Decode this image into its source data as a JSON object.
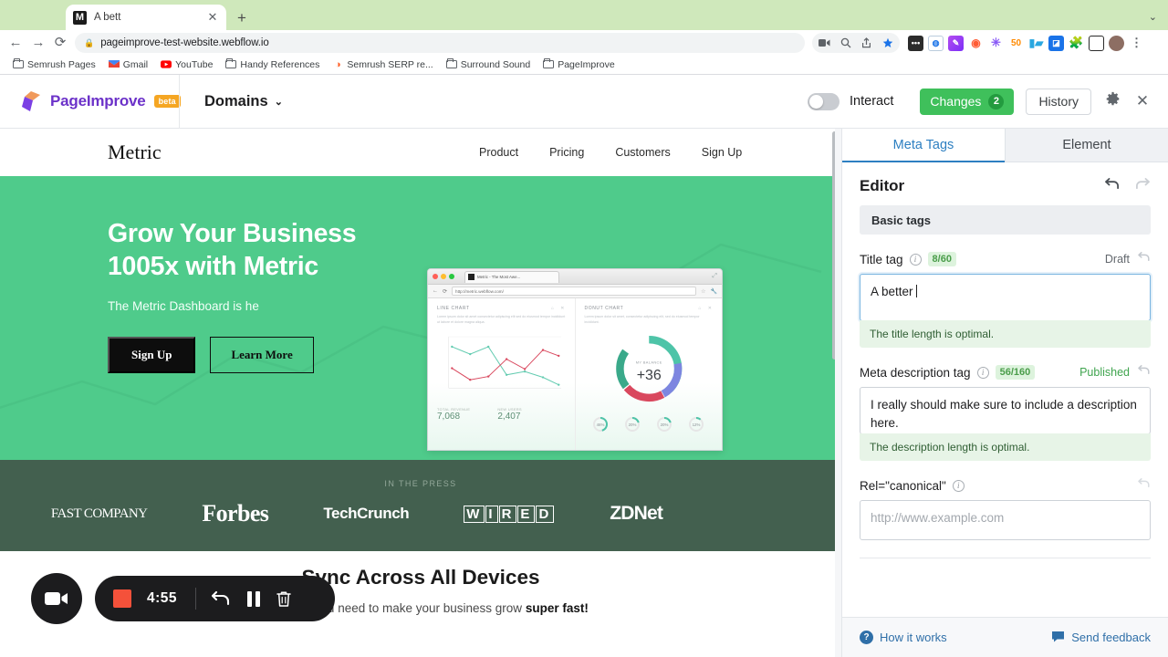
{
  "browser": {
    "tab": {
      "favicon_letter": "M",
      "title": "A bett",
      "close_label": "✕"
    },
    "new_tab_label": "+",
    "window_chevron": "⌄",
    "nav": {
      "back": "←",
      "forward": "→",
      "reload": "⟳"
    },
    "url": {
      "lock_icon": "lock-icon",
      "text": "pageimprove-test-website.webflow.io"
    },
    "toolbar_icons": [
      "video-call-icon",
      "search-icon",
      "share-icon",
      "bookmark-star-icon"
    ],
    "extensions": [
      "puzzle-dots-icon",
      "semrush-icon",
      "highlighter-icon",
      "eye-icon",
      "asterisk-icon",
      "fifty-icon",
      "grid-icon",
      "analytics-icon",
      "puzzle-icon",
      "sidebar-icon"
    ],
    "profile_icon": "avatar",
    "menu_icon": "kebab-menu-icon",
    "bookmarks": [
      {
        "label": "Semrush Pages",
        "icon": "folder-icon"
      },
      {
        "label": "Gmail",
        "icon": "gmail-icon"
      },
      {
        "label": "YouTube",
        "icon": "youtube-icon"
      },
      {
        "label": "Handy References",
        "icon": "folder-icon"
      },
      {
        "label": "Semrush SERP re...",
        "icon": "semrush-icon"
      },
      {
        "label": "Surround Sound",
        "icon": "folder-icon"
      },
      {
        "label": "PageImprove",
        "icon": "folder-icon"
      }
    ]
  },
  "app_header": {
    "brand": "PageImprove",
    "beta_label": "beta",
    "domains_label": "Domains",
    "domains_chevron": "⌄",
    "interact_label": "Interact",
    "interact_on": false,
    "changes_label": "Changes",
    "changes_count": "2",
    "history_label": "History",
    "settings_icon": "gear-icon",
    "close_icon": "close-icon",
    "accent_green": "#3fc05b",
    "brand_purple": "#6c32c9",
    "beta_orange": "#f5a623"
  },
  "website": {
    "logo": "Metric",
    "nav_links": [
      "Product",
      "Pricing",
      "Customers",
      "Sign Up"
    ],
    "hero": {
      "heading": "Grow Your Business 1005x with Metric",
      "subheading": "The Metric Dashboard is he",
      "primary_button": "Sign Up",
      "secondary_button": "Learn More",
      "bg_color": "#4fcb8b"
    },
    "mock_screenshot": {
      "tab_title": "Metric - The Most Awe...",
      "url": "http://metric.webflow.com/",
      "line_chart": {
        "title": "LINE CHART",
        "body": "Lorem ipsum dolor sit amet consectetur adipiscing elit sed do eiusmod tempor incididunt ut labore et dolore magna aliqua."
      },
      "donut_chart": {
        "title": "DONUT CHART",
        "body": "Lorem ipsum dolor sit amet, consectetur adipiscing elit, sed do eiusmod tempor incididunt.",
        "center_label": "MY BALANCE",
        "center_value": "+36"
      },
      "stats": [
        {
          "label": "TOTAL REVENUE",
          "value": "7,068"
        },
        {
          "label": "NEW USERS",
          "value": "2,407"
        }
      ],
      "mini_gauges": [
        "46%",
        "20%",
        "20%",
        "12%"
      ]
    },
    "press": {
      "caption": "IN THE PRESS",
      "logos": [
        "FAST COMPANY",
        "Forbes",
        "TechCrunch",
        "WIRED",
        "ZDNet"
      ],
      "bg_color": "#43604f"
    },
    "sync": {
      "heading": "Sync Across All Devices",
      "subtext_before": "Everything you need to make your business grow ",
      "subtext_bold": "super fast!"
    }
  },
  "recorder": {
    "camera_icon": "video-camera-icon",
    "stop_icon": "stop-square-icon",
    "time": "4:55",
    "undo_icon": "undo-arrow-icon",
    "pause_icon": "pause-icon",
    "delete_icon": "trash-icon",
    "stop_color": "#f4513a"
  },
  "panel": {
    "tabs": [
      {
        "label": "Meta Tags",
        "active": true
      },
      {
        "label": "Element",
        "active": false
      }
    ],
    "editor_title": "Editor",
    "undo_icon": "undo-icon",
    "redo_icon": "redo-icon",
    "section_label": "Basic tags",
    "fields": [
      {
        "label": "Title tag",
        "info_icon": "info-icon",
        "counter": "8/60",
        "status": "Draft",
        "revert_icon": "revert-icon",
        "value": "A better ",
        "hint": "The title length is optimal."
      },
      {
        "label": "Meta description tag",
        "info_icon": "info-icon",
        "counter": "56/160",
        "status": "Published",
        "revert_icon": "revert-icon",
        "value": "I really should make sure to include a description here.",
        "hint": "The description length is optimal."
      },
      {
        "label": "Rel=\"canonical\"",
        "info_icon": "info-icon",
        "revert_icon": "revert-icon",
        "placeholder": "http://www.example.com"
      }
    ],
    "footer": {
      "how_it_works": "How it works",
      "how_icon": "question-mark-icon",
      "send_feedback": "Send feedback",
      "feedback_icon": "chat-bubble-icon"
    }
  }
}
